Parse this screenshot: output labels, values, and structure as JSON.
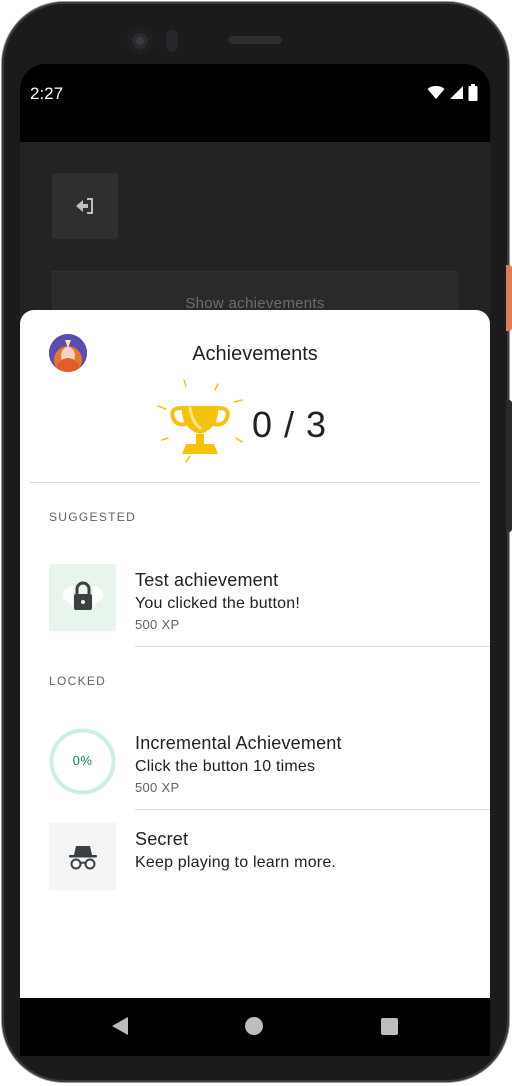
{
  "status_bar": {
    "time": "2:27"
  },
  "background_app": {
    "show_achievements_label": "Show achievements"
  },
  "sheet": {
    "title": "Achievements",
    "score": "0 / 3",
    "sections": {
      "suggested_label": "SUGGESTED",
      "locked_label": "LOCKED"
    },
    "suggested": [
      {
        "title": "Test achievement",
        "description": "You clicked the button!",
        "xp": "500 XP",
        "icon": "lock-icon"
      }
    ],
    "locked": [
      {
        "title": "Incremental Achievement",
        "description": "Click the button 10 times",
        "xp": "500 XP",
        "progress_text": "0%",
        "progress": 0
      },
      {
        "title": "Secret",
        "description": "Keep playing to learn more.",
        "icon": "incognito-icon"
      }
    ]
  },
  "colors": {
    "sheet_bg": "#ffffff",
    "app_bg": "#232323",
    "progress_ring": "#cdeee1",
    "progress_text": "#1e7a5a",
    "trophy": "#f4c20d",
    "suggested_icon_bg": "#e8f5ec"
  },
  "icons": [
    "exit-icon",
    "wifi-icon",
    "signal-icon",
    "battery-icon",
    "trophy-icon",
    "lock-icon",
    "incognito-icon",
    "back-icon",
    "home-icon",
    "recents-icon"
  ]
}
